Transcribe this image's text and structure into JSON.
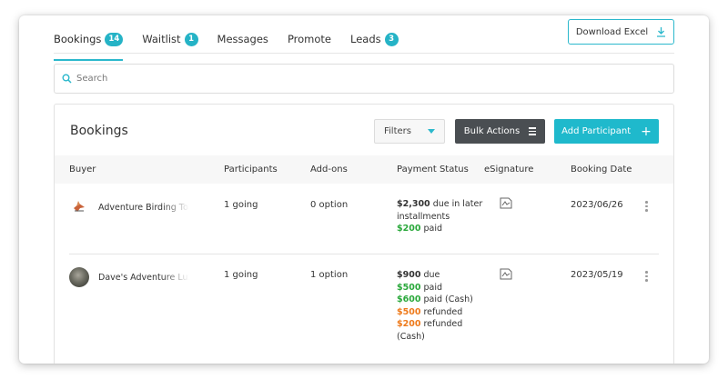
{
  "tabs": [
    {
      "label": "Bookings",
      "badge": "14"
    },
    {
      "label": "Waitlist",
      "badge": "1"
    },
    {
      "label": "Messages"
    },
    {
      "label": "Promote"
    },
    {
      "label": "Leads",
      "badge": "3"
    }
  ],
  "download_label": "Download Excel",
  "search": {
    "placeholder": "Search"
  },
  "panel": {
    "title": "Bookings",
    "filters_label": "Filters",
    "bulk_label": "Bulk Actions",
    "add_label": "Add Participant"
  },
  "columns": [
    "Buyer",
    "Participants",
    "Add-ons",
    "Payment Status",
    "eSignature",
    "Booking Date"
  ],
  "rows": [
    {
      "buyer": "Adventure Birding Tours",
      "participants": "1 going",
      "addons": "0 option",
      "payment": [
        {
          "amount": "$2,300",
          "text": " due in later",
          "color": "dark"
        },
        {
          "amount": "",
          "text": "installments",
          "color": "dark"
        },
        {
          "amount": "$200",
          "text": " paid",
          "color": "green"
        }
      ],
      "esignature_icon": "signature-document-icon",
      "date": "2023/06/26"
    },
    {
      "buyer": "Dave's Adventure Luxury",
      "participants": "1 going",
      "addons": "1 option",
      "payment": [
        {
          "amount": "$900",
          "text": " due",
          "color": "dark"
        },
        {
          "amount": "$500",
          "text": " paid",
          "color": "green"
        },
        {
          "amount": "$600",
          "text": " paid (Cash)",
          "color": "green"
        },
        {
          "amount": "$500",
          "text": " refunded",
          "color": "orange"
        },
        {
          "amount": "$200",
          "text": " refunded",
          "color": "orange"
        },
        {
          "amount": "",
          "text": "(Cash)",
          "color": "dark"
        }
      ],
      "esignature_icon": "signature-document-icon",
      "date": "2023/05/19"
    }
  ],
  "colors": {
    "accent": "#1fb9cc",
    "dark_button": "#4a4e52",
    "paid": "#2aa83b",
    "refunded": "#ee7a1b"
  }
}
